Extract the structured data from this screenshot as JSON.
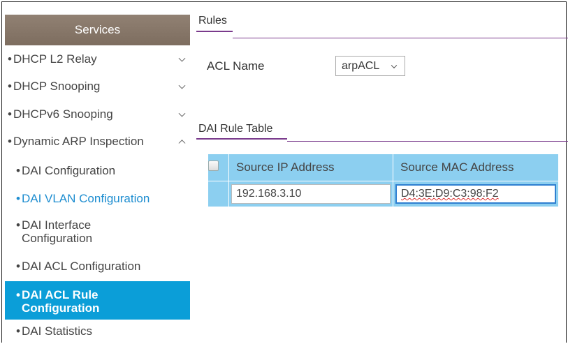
{
  "sidebar": {
    "header": "Services",
    "items": [
      {
        "label": "DHCP L2 Relay"
      },
      {
        "label": "DHCP Snooping"
      },
      {
        "label": "DHCPv6 Snooping"
      },
      {
        "label": "Dynamic ARP Inspection"
      }
    ],
    "sub_items": [
      {
        "label": "DAI Configuration"
      },
      {
        "label": "DAI VLAN Configuration"
      },
      {
        "label": "DAI Interface Configuration"
      },
      {
        "label": "DAI ACL Configuration"
      },
      {
        "label": "DAI ACL Rule Configuration"
      },
      {
        "label": "DAI Statistics"
      }
    ],
    "bullet": "•"
  },
  "main": {
    "rules_title": "Rules",
    "acl_name_label": "ACL Name",
    "acl_name_value": "arpACL",
    "table_title": "DAI Rule Table",
    "table": {
      "headers": [
        "Source IP Address",
        "Source MAC Address"
      ],
      "rows": [
        {
          "ip": "192.168.3.10",
          "mac": "D4:3E:D9:C3:98:F2"
        }
      ]
    }
  },
  "colors": {
    "accent_purple": "#7a3a8c",
    "table_blue": "#8ccff0",
    "active_blue": "#0b9ed8",
    "link_blue": "#1d8dd0",
    "header_brown": "#857566"
  }
}
